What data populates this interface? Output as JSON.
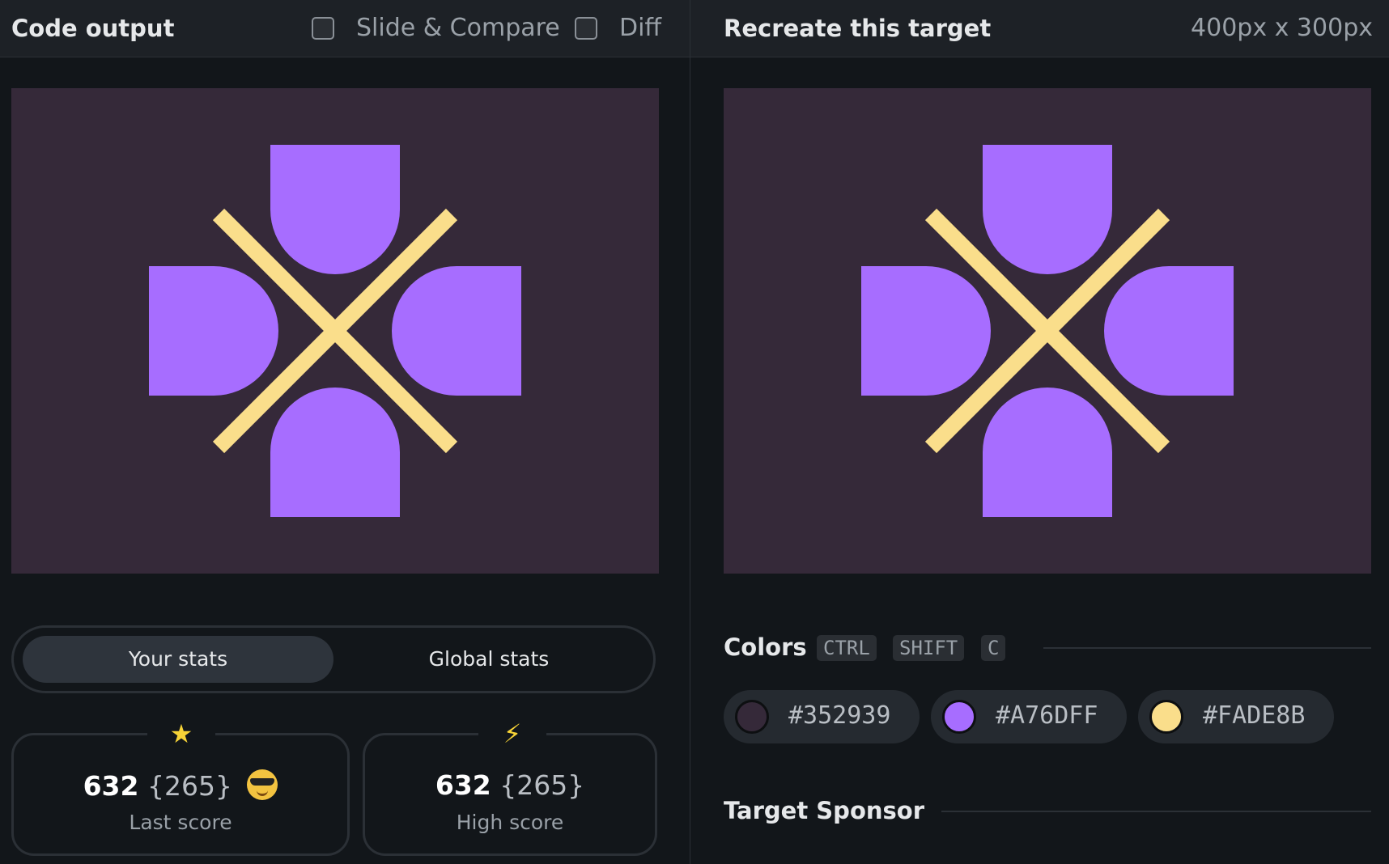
{
  "left_panel": {
    "title": "Code output",
    "slide_compare_label": "Slide & Compare",
    "diff_label": "Diff",
    "tabs": [
      {
        "label": "Your stats",
        "active": true
      },
      {
        "label": "Global stats",
        "active": false
      }
    ],
    "stats": [
      {
        "icon": "star-icon",
        "icon_glyph": "★",
        "score": "632",
        "alt_score": "{265}",
        "label": "Last score",
        "emoji": "sunglasses-emoji-icon"
      },
      {
        "icon": "lightning-icon",
        "icon_glyph": "⚡",
        "score": "632",
        "alt_score": "{265}",
        "label": "High score"
      }
    ]
  },
  "right_panel": {
    "title": "Recreate this target",
    "dimensions": "400px x 300px",
    "colors_heading": "Colors",
    "shortcut_keys": [
      "CTRL",
      "SHIFT",
      "C"
    ],
    "colors": [
      "#352939",
      "#A76DFF",
      "#FADE8B"
    ],
    "sponsor_heading": "Target Sponsor"
  },
  "theme": {
    "background": "#12161a",
    "target_background": "#352939",
    "shape_color": "#A76DFF",
    "line_color": "#FADE8B"
  }
}
